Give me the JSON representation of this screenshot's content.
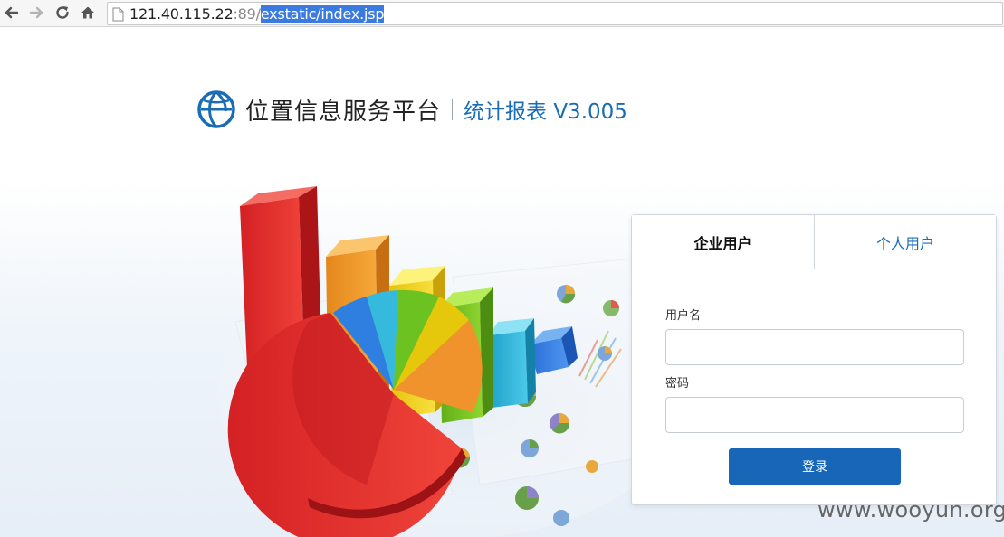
{
  "browser": {
    "url_host": "121.40.115.22",
    "url_port": ":89/",
    "url_path": "exstatic/index.jsp",
    "icons": [
      "back-icon",
      "forward-icon",
      "reload-icon",
      "home-icon",
      "page-icon"
    ]
  },
  "header": {
    "title": "位置信息服务平台",
    "subtitle": "统计报表 V3.005"
  },
  "login": {
    "tabs": [
      {
        "label": "企业用户",
        "active": true
      },
      {
        "label": "个人用户",
        "active": false
      }
    ],
    "username_label": "用户名",
    "username_value": "",
    "password_label": "密码",
    "password_value": "",
    "submit_label": "登录"
  },
  "watermark": "www.wooyun.org",
  "colors": {
    "accent": "#1766b8",
    "brand_blue": "#1a6db5"
  }
}
